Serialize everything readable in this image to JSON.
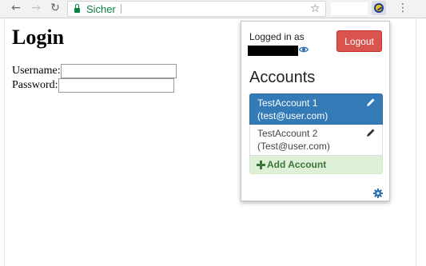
{
  "browser": {
    "secure_label": "Sicher",
    "icons": {
      "back": "arrow-left-icon",
      "forward": "arrow-right-icon",
      "reload": "reload-icon",
      "bookmark": "star-icon",
      "extension": "extension-icon",
      "menu": "more-vert-icon"
    }
  },
  "page": {
    "title": "Login",
    "username_label": "Username:",
    "password_label": "Password:"
  },
  "popup": {
    "logged_in_label": "Logged in as",
    "logout_label": "Logout",
    "accounts_title": "Accounts",
    "accounts": [
      {
        "name": "TestAccount 1",
        "email": "(test@user.com)",
        "active": true
      },
      {
        "name": "TestAccount 2",
        "email": "(Test@user.com)",
        "active": false
      }
    ],
    "add_account_label": "Add Account"
  },
  "colors": {
    "active_account": "#337ab7",
    "logout": "#d9534f",
    "add_account_bg": "#dff0d8",
    "add_account_text": "#3c763d",
    "settings_icon": "#2a6fb0",
    "secure_green": "#0b8043"
  }
}
